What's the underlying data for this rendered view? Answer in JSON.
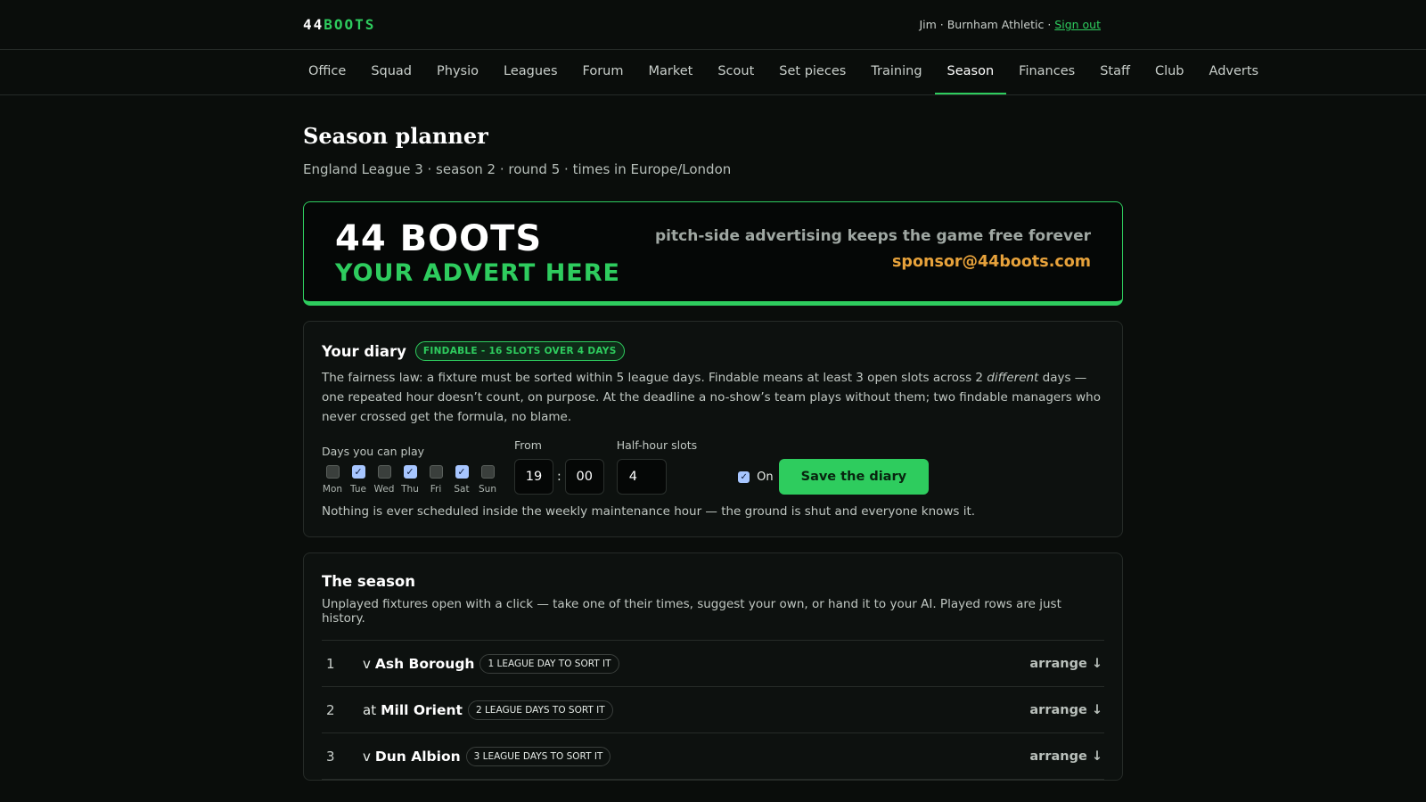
{
  "brand": {
    "logo_main": "44",
    "logo_accent": "BOOTS"
  },
  "user": {
    "info": "Jim · Burnham Athletic · ",
    "signout": "Sign out"
  },
  "nav": [
    {
      "label": "Office"
    },
    {
      "label": "Squad"
    },
    {
      "label": "Physio"
    },
    {
      "label": "Leagues"
    },
    {
      "label": "Forum"
    },
    {
      "label": "Market"
    },
    {
      "label": "Scout"
    },
    {
      "label": "Set pieces"
    },
    {
      "label": "Training"
    },
    {
      "label": "Season",
      "active": true
    },
    {
      "label": "Finances"
    },
    {
      "label": "Staff"
    },
    {
      "label": "Club"
    },
    {
      "label": "Adverts"
    }
  ],
  "page": {
    "title": "Season planner",
    "subtitle": "England League 3 · season 2 · round 5 · times in Europe/London"
  },
  "advert": {
    "brand": "44 BOOTS",
    "cta": "YOUR ADVERT HERE",
    "tagline": "pitch-side advertising keeps the game free forever",
    "email": "sponsor@44boots.com"
  },
  "diary": {
    "title": "Your diary",
    "badge": "FINDABLE - 16 SLOTS OVER 4 DAYS",
    "desc_1": "The fairness law: a fixture must be sorted within 5 league days. Findable means at least 3 open slots across 2 ",
    "desc_em": "different",
    "desc_2": " days — one repeated hour doesn’t count, on purpose. At the deadline a no-show’s team plays without them; two findable managers who never crossed get the formula, no blame.",
    "days_label": "Days you can play",
    "days": [
      {
        "label": "Mon",
        "checked": false
      },
      {
        "label": "Tue",
        "checked": true
      },
      {
        "label": "Wed",
        "checked": false
      },
      {
        "label": "Thu",
        "checked": true
      },
      {
        "label": "Fri",
        "checked": false
      },
      {
        "label": "Sat",
        "checked": true
      },
      {
        "label": "Sun",
        "checked": false
      }
    ],
    "from_label": "From",
    "from_hour": "19",
    "from_minute": "00",
    "slots_label": "Half-hour slots",
    "slots_value": "4",
    "on_label": "On",
    "on_checked": true,
    "save_label": "Save the diary",
    "note": "Nothing is ever scheduled inside the weekly maintenance hour — the ground is shut and everyone knows it."
  },
  "season": {
    "title": "The season",
    "desc": "Unplayed fixtures open with a click — take one of their times, suggest your own, or hand it to your AI. Played rows are just history.",
    "fixtures": [
      {
        "num": "1",
        "prefix": "v",
        "team": "Ash Borough",
        "tag": "1 LEAGUE DAY TO SORT IT",
        "action": "arrange ↓"
      },
      {
        "num": "2",
        "prefix": "at",
        "team": "Mill Orient",
        "tag": "2 LEAGUE DAYS TO SORT IT",
        "action": "arrange ↓"
      },
      {
        "num": "3",
        "prefix": "v",
        "team": "Dun Albion",
        "tag": "3 LEAGUE DAYS TO SORT IT",
        "action": "arrange ↓"
      }
    ]
  },
  "colors": {
    "accent": "#2ecc5e",
    "email": "#e7a23b",
    "checkbox_on": "#a7c6ff"
  }
}
